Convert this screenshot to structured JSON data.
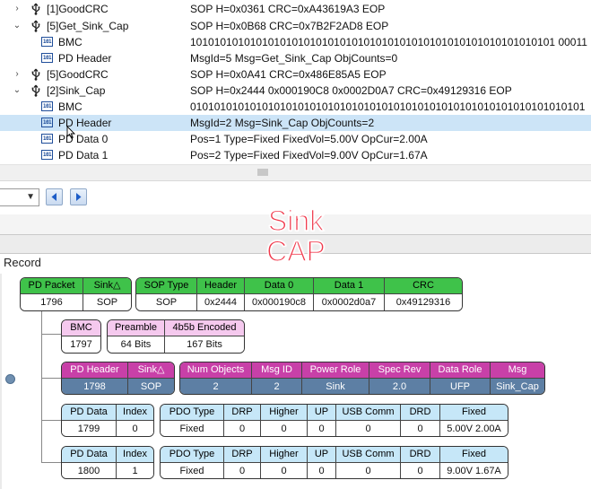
{
  "tree": {
    "rows": [
      {
        "name": "[1]GoodCRC",
        "value": "SOP H=0x0361 CRC=0xA43619A3 EOP"
      },
      {
        "name": "[5]Get_Sink_Cap",
        "value": "SOP H=0x0B68 CRC=0x7B2F2AD8 EOP"
      },
      {
        "name": "BMC",
        "value": "1010101010101010101010101010101010101010101010101010101010101 00011"
      },
      {
        "name": "PD Header",
        "value": "MsgId=5 Msg=Get_Sink_Cap ObjCounts=0"
      },
      {
        "name": "[5]GoodCRC",
        "value": "SOP H=0x0A41 CRC=0x486E85A5 EOP"
      },
      {
        "name": "[2]Sink_Cap",
        "value": "SOP H=0x2444 0x000190C8 0x0002D0A7 CRC=0x49129316 EOP"
      },
      {
        "name": "BMC",
        "value": "010101010101010101010101010101010101010101010101010101010101010101"
      },
      {
        "name": "PD Header",
        "value": "MsgId=2 Msg=Sink_Cap ObjCounts=2"
      },
      {
        "name": "PD Data 0",
        "value": "Pos=1 Type=Fixed FixedVol=5.00V OpCur=2.00A"
      },
      {
        "name": "PD Data 1",
        "value": "Pos=2 Type=Fixed FixedVol=9.00V OpCur=1.67A"
      }
    ]
  },
  "overlay": {
    "line1": "Sink",
    "line2": "CAP"
  },
  "record": {
    "title": "Record",
    "pd_packet": {
      "h1": "PD Packet",
      "h2": "Sink△",
      "v1": "1796",
      "v2": "SOP"
    },
    "sop_table": {
      "headers": [
        "SOP Type",
        "Header",
        "Data 0",
        "Data 1",
        "CRC"
      ],
      "values": [
        "SOP",
        "0x2444",
        "0x000190c8",
        "0x0002d0a7",
        "0x49129316"
      ]
    },
    "bmc": {
      "h": "BMC",
      "v": "1797"
    },
    "preamble": {
      "headers": [
        "Preamble",
        "4b5b Encoded"
      ],
      "values": [
        "64 Bits",
        "167 Bits"
      ]
    },
    "pd_header": {
      "h1": "PD Header",
      "h2": "Sink△",
      "v1": "1798",
      "v2": "SOP"
    },
    "header_fields": {
      "headers": [
        "Num Objects",
        "Msg ID",
        "Power Role",
        "Spec Rev",
        "Data Role",
        "Msg"
      ],
      "values": [
        "2",
        "2",
        "Sink",
        "2.0",
        "UFP",
        "Sink_Cap"
      ]
    },
    "data_rows": [
      {
        "id_headers": [
          "PD Data",
          "Index"
        ],
        "id_values": [
          "1799",
          "0"
        ],
        "pdo_headers": [
          "PDO Type",
          "DRP",
          "Higher",
          "UP",
          "USB Comm",
          "DRD",
          "Fixed"
        ],
        "pdo_values": [
          "Fixed",
          "0",
          "0",
          "0",
          "0",
          "0",
          "5.00V 2.00A"
        ]
      },
      {
        "id_headers": [
          "PD Data",
          "Index"
        ],
        "id_values": [
          "1800",
          "1"
        ],
        "pdo_headers": [
          "PDO Type",
          "DRP",
          "Higher",
          "UP",
          "USB Comm",
          "DRD",
          "Fixed"
        ],
        "pdo_values": [
          "Fixed",
          "0",
          "0",
          "0",
          "0",
          "0",
          "9.00V 1.67A"
        ]
      }
    ]
  },
  "colors": {
    "green": "#3fc24a",
    "pink": "#f5c9ee",
    "magenta": "#c840a8",
    "steel": "#5d7fa4",
    "light_blue": "#c6e7f8",
    "selection": "#cce4f7",
    "overlay_red": "#f0384b"
  },
  "icons": {
    "usb": "usb-icon",
    "binary": "binary-data-icon",
    "back": "arrow-left-icon",
    "forward": "arrow-right-icon",
    "expand": "chevron-down-icon",
    "collapse": "chevron-right-icon"
  }
}
